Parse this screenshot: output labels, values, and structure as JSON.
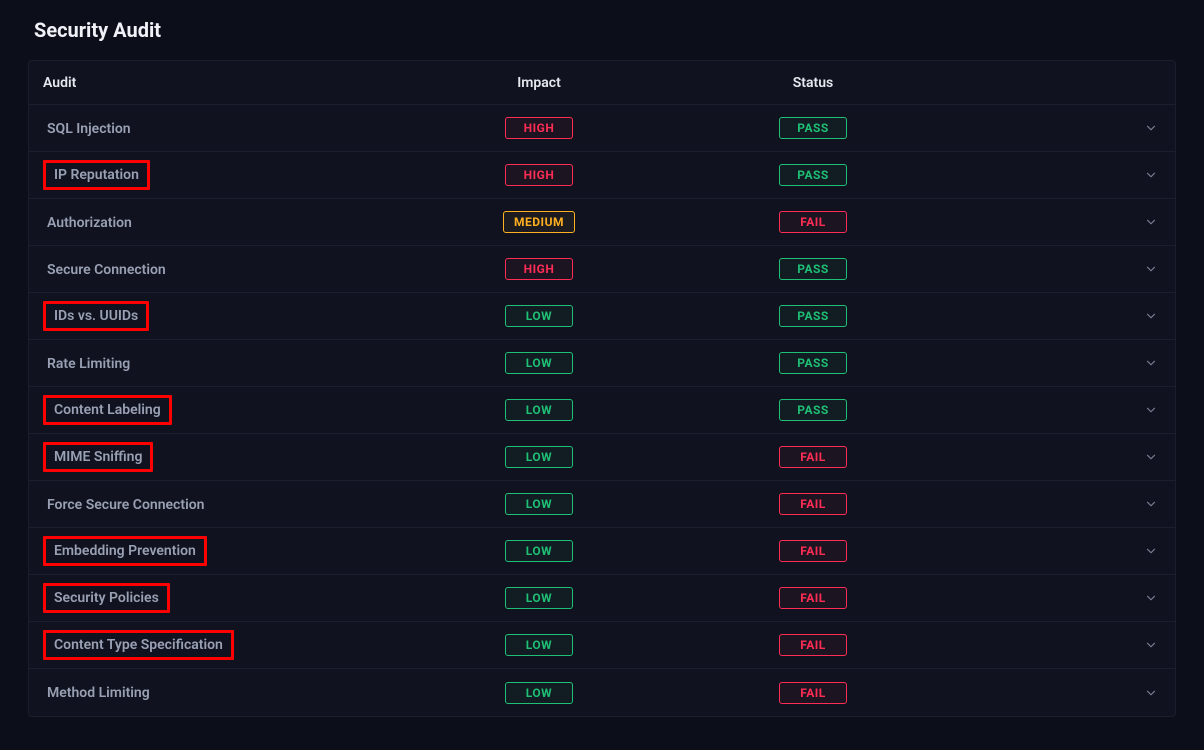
{
  "title": "Security Audit",
  "columns": {
    "audit": "Audit",
    "impact": "Impact",
    "status": "Status"
  },
  "impact_labels": {
    "HIGH": "HIGH",
    "MEDIUM": "MEDIUM",
    "LOW": "LOW"
  },
  "status_labels": {
    "PASS": "PASS",
    "FAIL": "FAIL"
  },
  "rows": [
    {
      "name": "SQL Injection",
      "impact": "HIGH",
      "status": "PASS",
      "highlighted": false
    },
    {
      "name": "IP Reputation",
      "impact": "HIGH",
      "status": "PASS",
      "highlighted": true
    },
    {
      "name": "Authorization",
      "impact": "MEDIUM",
      "status": "FAIL",
      "highlighted": false
    },
    {
      "name": "Secure Connection",
      "impact": "HIGH",
      "status": "PASS",
      "highlighted": false
    },
    {
      "name": "IDs vs. UUIDs",
      "impact": "LOW",
      "status": "PASS",
      "highlighted": true
    },
    {
      "name": "Rate Limiting",
      "impact": "LOW",
      "status": "PASS",
      "highlighted": false
    },
    {
      "name": "Content Labeling",
      "impact": "LOW",
      "status": "PASS",
      "highlighted": true
    },
    {
      "name": "MIME Sniffing",
      "impact": "LOW",
      "status": "FAIL",
      "highlighted": true
    },
    {
      "name": "Force Secure Connection",
      "impact": "LOW",
      "status": "FAIL",
      "highlighted": false
    },
    {
      "name": "Embedding Prevention",
      "impact": "LOW",
      "status": "FAIL",
      "highlighted": true
    },
    {
      "name": "Security Policies",
      "impact": "LOW",
      "status": "FAIL",
      "highlighted": true
    },
    {
      "name": "Content Type Specification",
      "impact": "LOW",
      "status": "FAIL",
      "highlighted": true
    },
    {
      "name": "Method Limiting",
      "impact": "LOW",
      "status": "FAIL",
      "highlighted": false
    }
  ]
}
